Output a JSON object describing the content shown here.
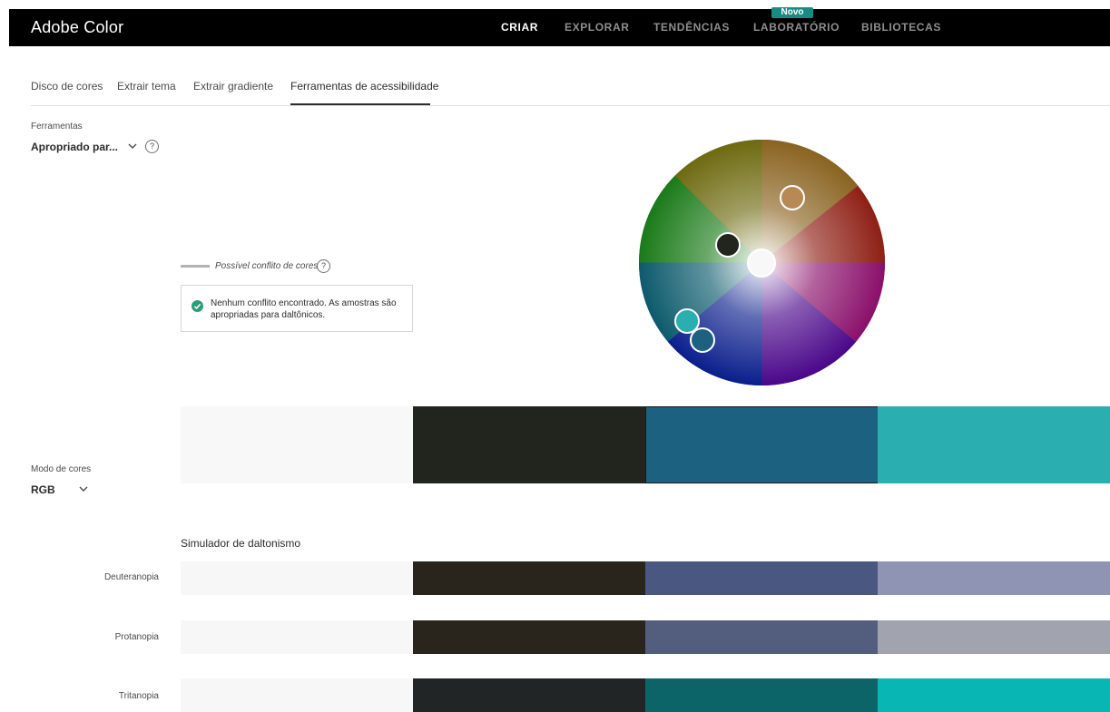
{
  "app": {
    "title": "Adobe Color"
  },
  "nav": {
    "items": [
      {
        "label": "CRIAR",
        "active": true
      },
      {
        "label": "EXPLORAR",
        "active": false
      },
      {
        "label": "TENDÊNCIAS",
        "active": false
      },
      {
        "label": "LABORATÓRIO",
        "active": false
      },
      {
        "label": "BIBLIOTECAS",
        "active": false
      }
    ],
    "badge": "Novo"
  },
  "tabs": [
    {
      "label": "Disco de cores",
      "active": false
    },
    {
      "label": "Extrair tema",
      "active": false
    },
    {
      "label": "Extrair gradiente",
      "active": false
    },
    {
      "label": "Ferramentas de acessibilidade",
      "active": true
    }
  ],
  "tools": {
    "label": "Ferramentas",
    "value": "Apropriado par...",
    "help": "?"
  },
  "legend": {
    "text": "Possível conflito de cores",
    "help": "?"
  },
  "result": {
    "message": "Nenhum conflito encontrado. As amostras são apropriadas para daltônicos.",
    "status_color": "#2d9d78"
  },
  "color_mode": {
    "label": "Modo de cores",
    "value": "RGB"
  },
  "swatches": [
    {
      "color": "#f8f8f8",
      "selected": false
    },
    {
      "color": "#22251d",
      "selected": false
    },
    {
      "color": "#1d6180",
      "selected": true
    },
    {
      "color": "#2aaeb0",
      "selected": false
    }
  ],
  "simulator": {
    "title": "Simulador de daltonismo",
    "rows": [
      {
        "label": "Deuteranopia",
        "colors": [
          "#f7f7f7",
          "#29251c",
          "#4a5781",
          "#8e94b1"
        ]
      },
      {
        "label": "Protanopia",
        "colors": [
          "#f7f7f7",
          "#29251c",
          "#535e7f",
          "#a1a3af"
        ]
      },
      {
        "label": "Tritanopia",
        "colors": [
          "#f7f7f7",
          "#222525",
          "#0d6468",
          "#08b6b3"
        ]
      }
    ]
  },
  "wheel_markers": [
    {
      "name": "marker-tan",
      "color": "#b78a55"
    },
    {
      "name": "marker-dark",
      "color": "#22251d"
    },
    {
      "name": "marker-white",
      "color": "#f8f8f8"
    },
    {
      "name": "marker-teal",
      "color": "#2aaeb0"
    },
    {
      "name": "marker-blue",
      "color": "#1d6180"
    }
  ]
}
